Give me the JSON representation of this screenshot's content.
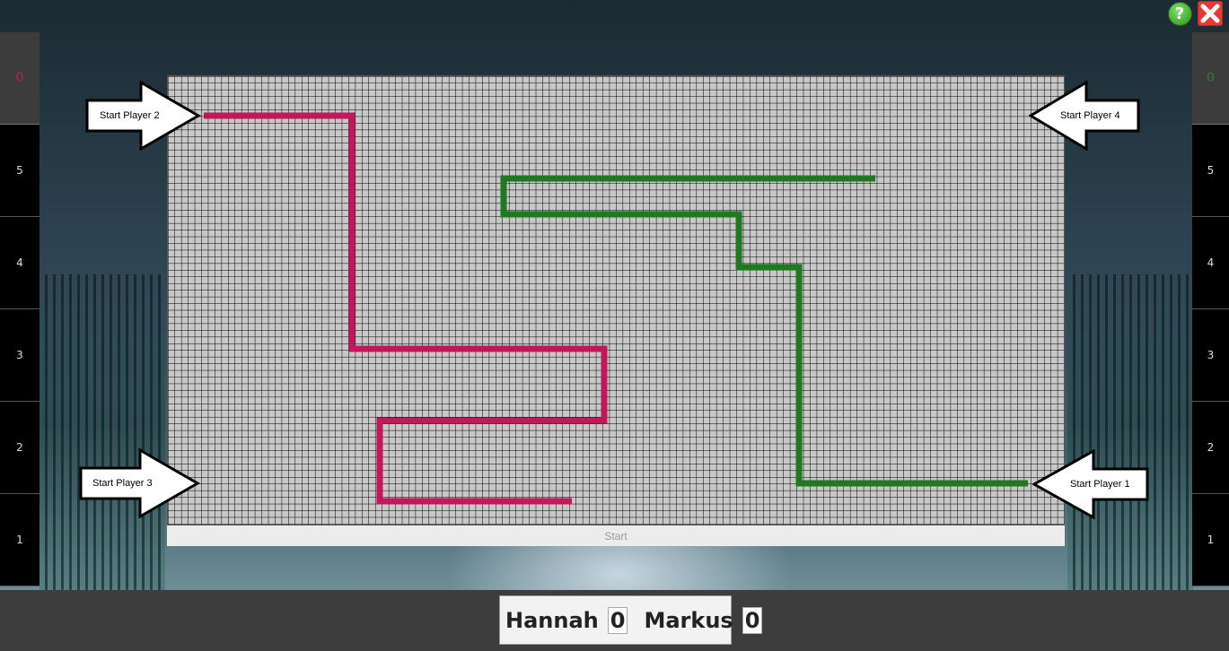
{
  "window": {
    "help_icon": "question-mark-icon",
    "close_icon": "close-x-icon",
    "help_label": "?"
  },
  "left_panel": {
    "score": "0",
    "score_color": "#c2185b",
    "levels": [
      "5",
      "4",
      "3",
      "2",
      "1"
    ]
  },
  "right_panel": {
    "score": "0",
    "score_color": "#2e7d32",
    "levels": [
      "5",
      "4",
      "3",
      "2",
      "1"
    ]
  },
  "board": {
    "grid_cols": 75,
    "grid_rows": 37,
    "grid_color": "#000000",
    "cell_color": "#c8c8c8",
    "start_label": "Start"
  },
  "arrows": {
    "player1": "Start Player 1",
    "player2": "Start Player 2",
    "player3": "Start Player 3",
    "player4": "Start Player 4"
  },
  "players": [
    {
      "name": "Hannah",
      "score": "0",
      "color": "#c2185b"
    },
    {
      "name": "Markus",
      "score": "0",
      "color": "#1e7a1e"
    }
  ]
}
